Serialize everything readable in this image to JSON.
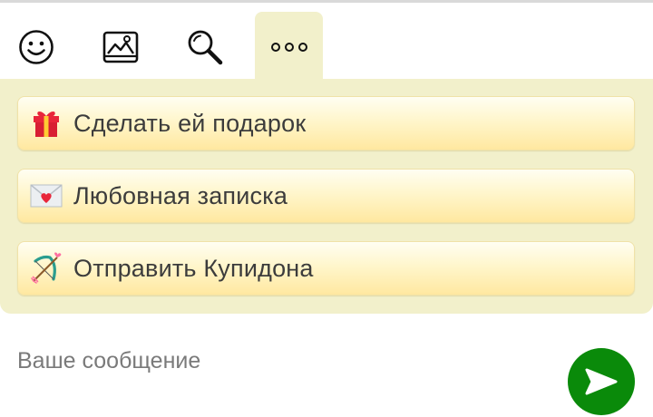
{
  "toolbar": {
    "icons": [
      "smiley-icon",
      "image-icon",
      "search-icon",
      "more-icon"
    ]
  },
  "actions": [
    {
      "label": "Сделать ей подарок",
      "icon": "gift-icon"
    },
    {
      "label": "Любовная записка",
      "icon": "love-letter-icon"
    },
    {
      "label": "Отправить Купидона",
      "icon": "cupid-bow-icon"
    }
  ],
  "composer": {
    "placeholder": "Ваше сообщение",
    "value": ""
  },
  "colors": {
    "panel_bg": "#f2f0cb",
    "send_button": "#0a8a0a"
  }
}
